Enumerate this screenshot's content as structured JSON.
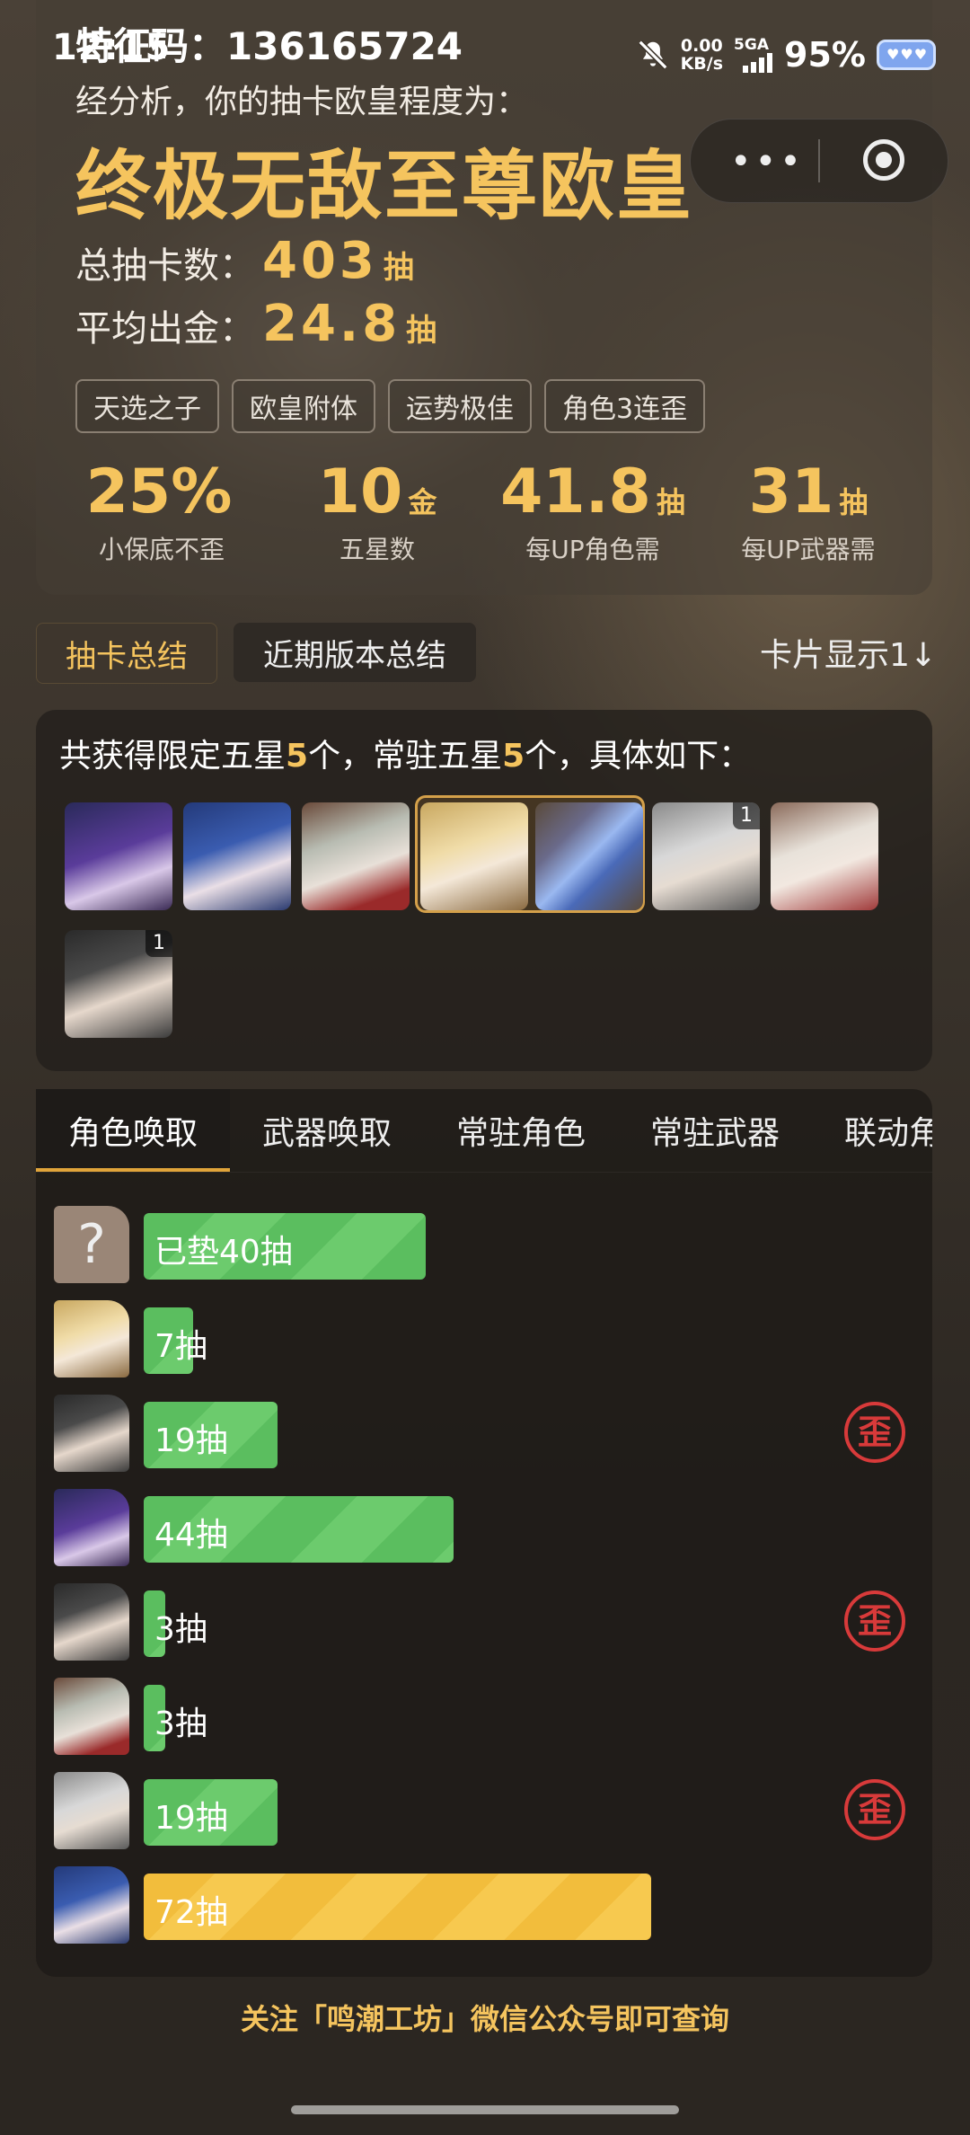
{
  "status": {
    "time": "12:15",
    "speed_value": "0.00",
    "speed_unit": "KB/s",
    "network": "5GA",
    "battery": "95%"
  },
  "profile": {
    "feature_code_label": "特征码：",
    "feature_code": "136165724",
    "analysis_text": "经分析，你的抽卡欧皇程度为：",
    "rank_title": "终极无敌至尊欧皇",
    "total_pulls_label": "总抽卡数：",
    "total_pulls": "403",
    "total_pulls_unit": "抽",
    "avg_gold_label": "平均出金：",
    "avg_gold": "24.8",
    "avg_gold_unit": "抽",
    "tags": [
      "天选之子",
      "欧皇附体",
      "运势极佳",
      "角色3连歪"
    ]
  },
  "metrics": [
    {
      "value": "25%",
      "unit": "",
      "label": "小保底不歪"
    },
    {
      "value": "10",
      "unit": "金",
      "label": "五星数"
    },
    {
      "value": "41.8",
      "unit": "抽",
      "label": "每UP角色需"
    },
    {
      "value": "31",
      "unit": "抽",
      "label": "每UP武器需"
    }
  ],
  "tabs": {
    "summary": "抽卡总结",
    "recent": "近期版本总结",
    "card_display": "卡片显示1↓"
  },
  "summary": {
    "text_a": "共获得限定五星",
    "limited_count": "5",
    "text_b": "个，常驻五星",
    "standard_count": "5",
    "text_c": "个，具体如下："
  },
  "portrait_badges": {
    "p6": "1",
    "p8": "1"
  },
  "history_tabs": [
    "角色唤取",
    "武器唤取",
    "常驻角色",
    "常驻武器",
    "联动角色"
  ],
  "history": [
    {
      "label": "已垫40抽",
      "pulls": 40,
      "color": "green",
      "wai": false,
      "unknown": true
    },
    {
      "label": "7抽",
      "pulls": 7,
      "color": "green",
      "wai": false
    },
    {
      "label": "19抽",
      "pulls": 19,
      "color": "green",
      "wai": true
    },
    {
      "label": "44抽",
      "pulls": 44,
      "color": "green",
      "wai": false
    },
    {
      "label": "3抽",
      "pulls": 3,
      "color": "green",
      "wai": true
    },
    {
      "label": "3抽",
      "pulls": 3,
      "color": "green",
      "wai": false
    },
    {
      "label": "19抽",
      "pulls": 19,
      "color": "green",
      "wai": true
    },
    {
      "label": "72抽",
      "pulls": 72,
      "color": "gold",
      "wai": false
    }
  ],
  "wai_badge": "歪",
  "unknown_avatar": "?",
  "footer": "关注「鸣潮工坊」微信公众号即可查询",
  "colors": {
    "accent": "#f5c45e",
    "green": "#5bbe5f",
    "gold": "#f2bd3c",
    "wai_red": "#d83a3a"
  }
}
